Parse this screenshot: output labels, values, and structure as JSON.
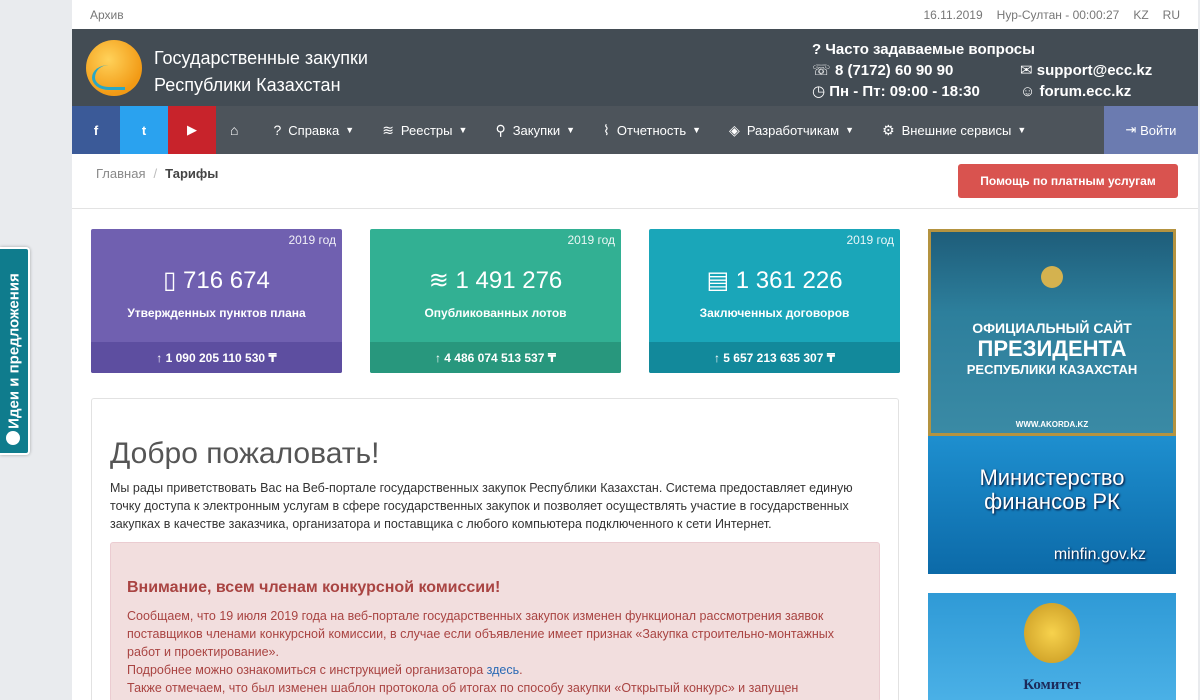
{
  "side_tab": {
    "label": "Идеи и предложения"
  },
  "topbar": {
    "archive": "Архив",
    "date": "16.11.2019",
    "time": "Нур-Султан - 00:00:27",
    "lang_kz": "KZ",
    "lang_ru": "RU"
  },
  "header": {
    "title_line1": "Государственные закупки",
    "title_line2": "Республики Казахстан",
    "faq": "Часто задаваемые вопросы",
    "phone": "8 (7172) 60 90 90",
    "email": "support@ecc.kz",
    "hours": "Пн - Пт: 09:00 - 18:30",
    "forum": "forum.ecc.kz"
  },
  "nav": {
    "facebook": "f",
    "twitter": "t",
    "youtube": "▶",
    "items": [
      {
        "label": "Справка"
      },
      {
        "label": "Реестры"
      },
      {
        "label": "Закупки"
      },
      {
        "label": "Отчетность"
      },
      {
        "label": "Разработчикам"
      },
      {
        "label": "Внешние сервисы"
      }
    ],
    "login": "Войти"
  },
  "breadcrumb": {
    "home": "Главная",
    "current": "Тарифы"
  },
  "help_button": "Помощь по платным услугам",
  "stats": [
    {
      "year": "2019 год",
      "value": "716 674",
      "label": "Утвержденных пунктов плана",
      "total": "1 090 205 110 530 ₸"
    },
    {
      "year": "2019 год",
      "value": "1 491 276",
      "label": "Опубликованных лотов",
      "total": "4 486 074 513 537 ₸"
    },
    {
      "year": "2019 год",
      "value": "1 361 226",
      "label": "Заключенных договоров",
      "total": "5 657 213 635 307 ₸"
    }
  ],
  "welcome": {
    "title": "Добро пожаловать!",
    "intro": "Мы рады приветствовать Вас на Веб-портале государственных закупок Республики Казахстан. Система предоставляет единую точку доступа к электронным услугам в сфере государственных закупок и позволяет осуществлять участие в государственных закупках в качестве заказчика, организатора и поставщика с любого компьютера подключенного к сети Интернет."
  },
  "alert": {
    "title": "Внимание, всем членам конкурсной комиссии!",
    "p1": "Сообщаем, что 19 июля 2019 года на веб-портале государственных закупок изменен функционал рассмотрения заявок поставщиков членами конкурсной комиссии, в случае если объявление имеет признак «Закупка строительно-монтажных работ и проектирование».",
    "p2": "Подробнее можно ознакомиться с инструкцией организатора ",
    "link": "здесь",
    "p2_end": ".",
    "p3": "Также отмечаем, что был изменен шаблон протокола об итогах по способу закупки «Открытый конкурс» и запущен"
  },
  "banners": {
    "president_line1": "ОФИЦИАЛЬНЫЙ САЙТ",
    "president_line2": "ПРЕЗИДЕНТА",
    "president_line3": "РЕСПУБЛИКИ КАЗАХСТАН",
    "president_url": "WWW.AKORDA.KZ",
    "minfin_line1": "Министерство",
    "minfin_line2": "финансов РК",
    "minfin_url": "minfin.gov.kz",
    "committee": "Комитет"
  }
}
